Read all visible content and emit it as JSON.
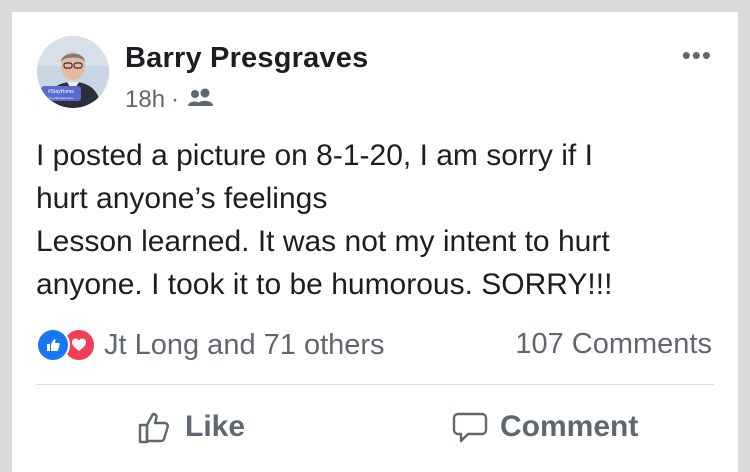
{
  "post": {
    "author": "Barry Presgraves",
    "time": "18h",
    "separator": "·",
    "audience_icon": "friends-icon",
    "more_label": "•••",
    "avatar": {
      "badge_title": "#StayHome",
      "badge_sub": "It could save lives"
    },
    "text_lines": [
      "I posted a picture on 8-1-20, I am sorry if I",
      "hurt anyone’s feelings",
      "Lesson learned. It was not my intent to hurt",
      "anyone.  I took it to be humorous. SORRY!!!"
    ]
  },
  "engagement": {
    "reactions_text": "Jt Long and 71 others",
    "comments_text": "107 Comments",
    "reaction_icons": [
      "like-reaction-icon",
      "love-reaction-icon"
    ]
  },
  "actions": {
    "like_label": "Like",
    "comment_label": "Comment"
  },
  "colors": {
    "like_blue": "#1877f2",
    "love_red": "#f33e58",
    "secondary_text": "#606770",
    "primary_text": "#1c1e21"
  }
}
